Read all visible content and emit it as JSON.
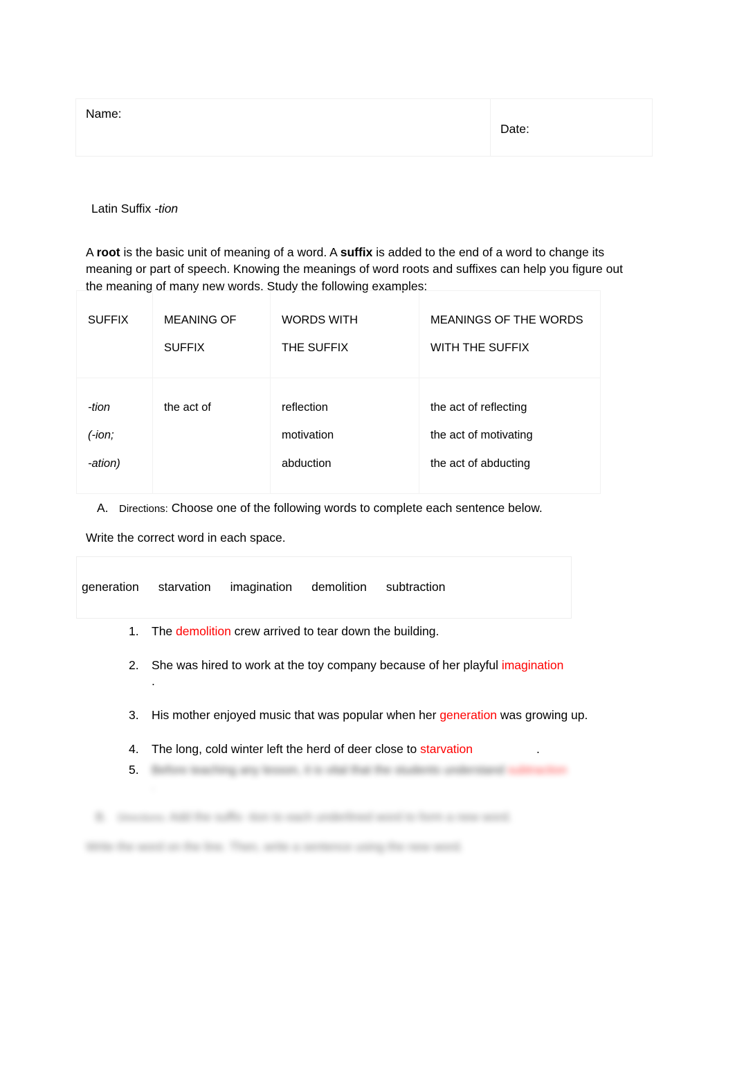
{
  "document": {
    "title": "Latin Suffix -tion",
    "title_plain": "Latin Suffix ",
    "title_italic": "-tion"
  },
  "header": {
    "name_label": "Name:",
    "date_label": "Date:"
  },
  "intro": {
    "part1": "A ",
    "bold1": "root",
    "part2": " is the basic unit of meaning of a word. A ",
    "bold2": "suffix",
    "part3": " is added to the end of a word to change its meaning or part of speech. Knowing the meanings of word roots and suffixes can help you figure out the meaning of many new words. Study the following examples:"
  },
  "suffix_table": {
    "headers": {
      "col1": "SUFFIX",
      "col2_line1": "MEANING OF",
      "col2_line2": "SUFFIX",
      "col3_line1": "WORDS WITH",
      "col3_line2": "THE SUFFIX",
      "col4_line1": "MEANINGS OF THE WORDS",
      "col4_line2": "WITH THE SUFFIX"
    },
    "row": {
      "suffix_line1": "-tion",
      "suffix_line2": "(-ion;",
      "suffix_line3": "-ation)",
      "meaning": "the act of",
      "words_line1": "reflection",
      "words_line2": "motivation",
      "words_line3": "abduction",
      "meanings_line1": "the act of reflecting",
      "meanings_line2": "the act of motivating",
      "meanings_line3": "the act of abducting"
    }
  },
  "section_a": {
    "letter": "A.",
    "directions_label": "Directions:",
    "directions_text": " Choose one of the following words to complete each sentence below.",
    "second_line": "Write the correct word in each space."
  },
  "word_bank": {
    "words": [
      "generation",
      "starvation",
      "imagination",
      "demolition",
      "subtraction"
    ]
  },
  "questions": [
    {
      "number": "1.",
      "before": "The ",
      "answer": "demolition",
      "after": " crew arrived to tear down the building."
    },
    {
      "number": "2.",
      "before": " She was hired to work at the toy company because of her playful ",
      "answer": "imagination",
      "after": "",
      "trailing": "."
    },
    {
      "number": "3.",
      "before": " His mother enjoyed music that was popular when her ",
      "answer": "generation",
      "after": " was growing up."
    },
    {
      "number": "4.",
      "before": " The long, cold winter left the herd of deer close to ",
      "answer": "starvation",
      "after": "."
    }
  ],
  "question_5": {
    "number": "5.",
    "blurred_text": "Before teaching any lesson, it is vital that the students understand ",
    "blurred_answer": "subtraction",
    "trailing": "."
  },
  "section_b_blurred": {
    "letter": "B.",
    "directions_label": "Directions:",
    "line1": " Add the suffix -tion to each underlined word to form a new word.",
    "line2": "Write the word on the line. Then, write a sentence using the new word."
  },
  "colors": {
    "answer_red": "#ff0000",
    "text_black": "#000000",
    "table_border": "#f0f0f0",
    "page_background": "#ffffff"
  }
}
